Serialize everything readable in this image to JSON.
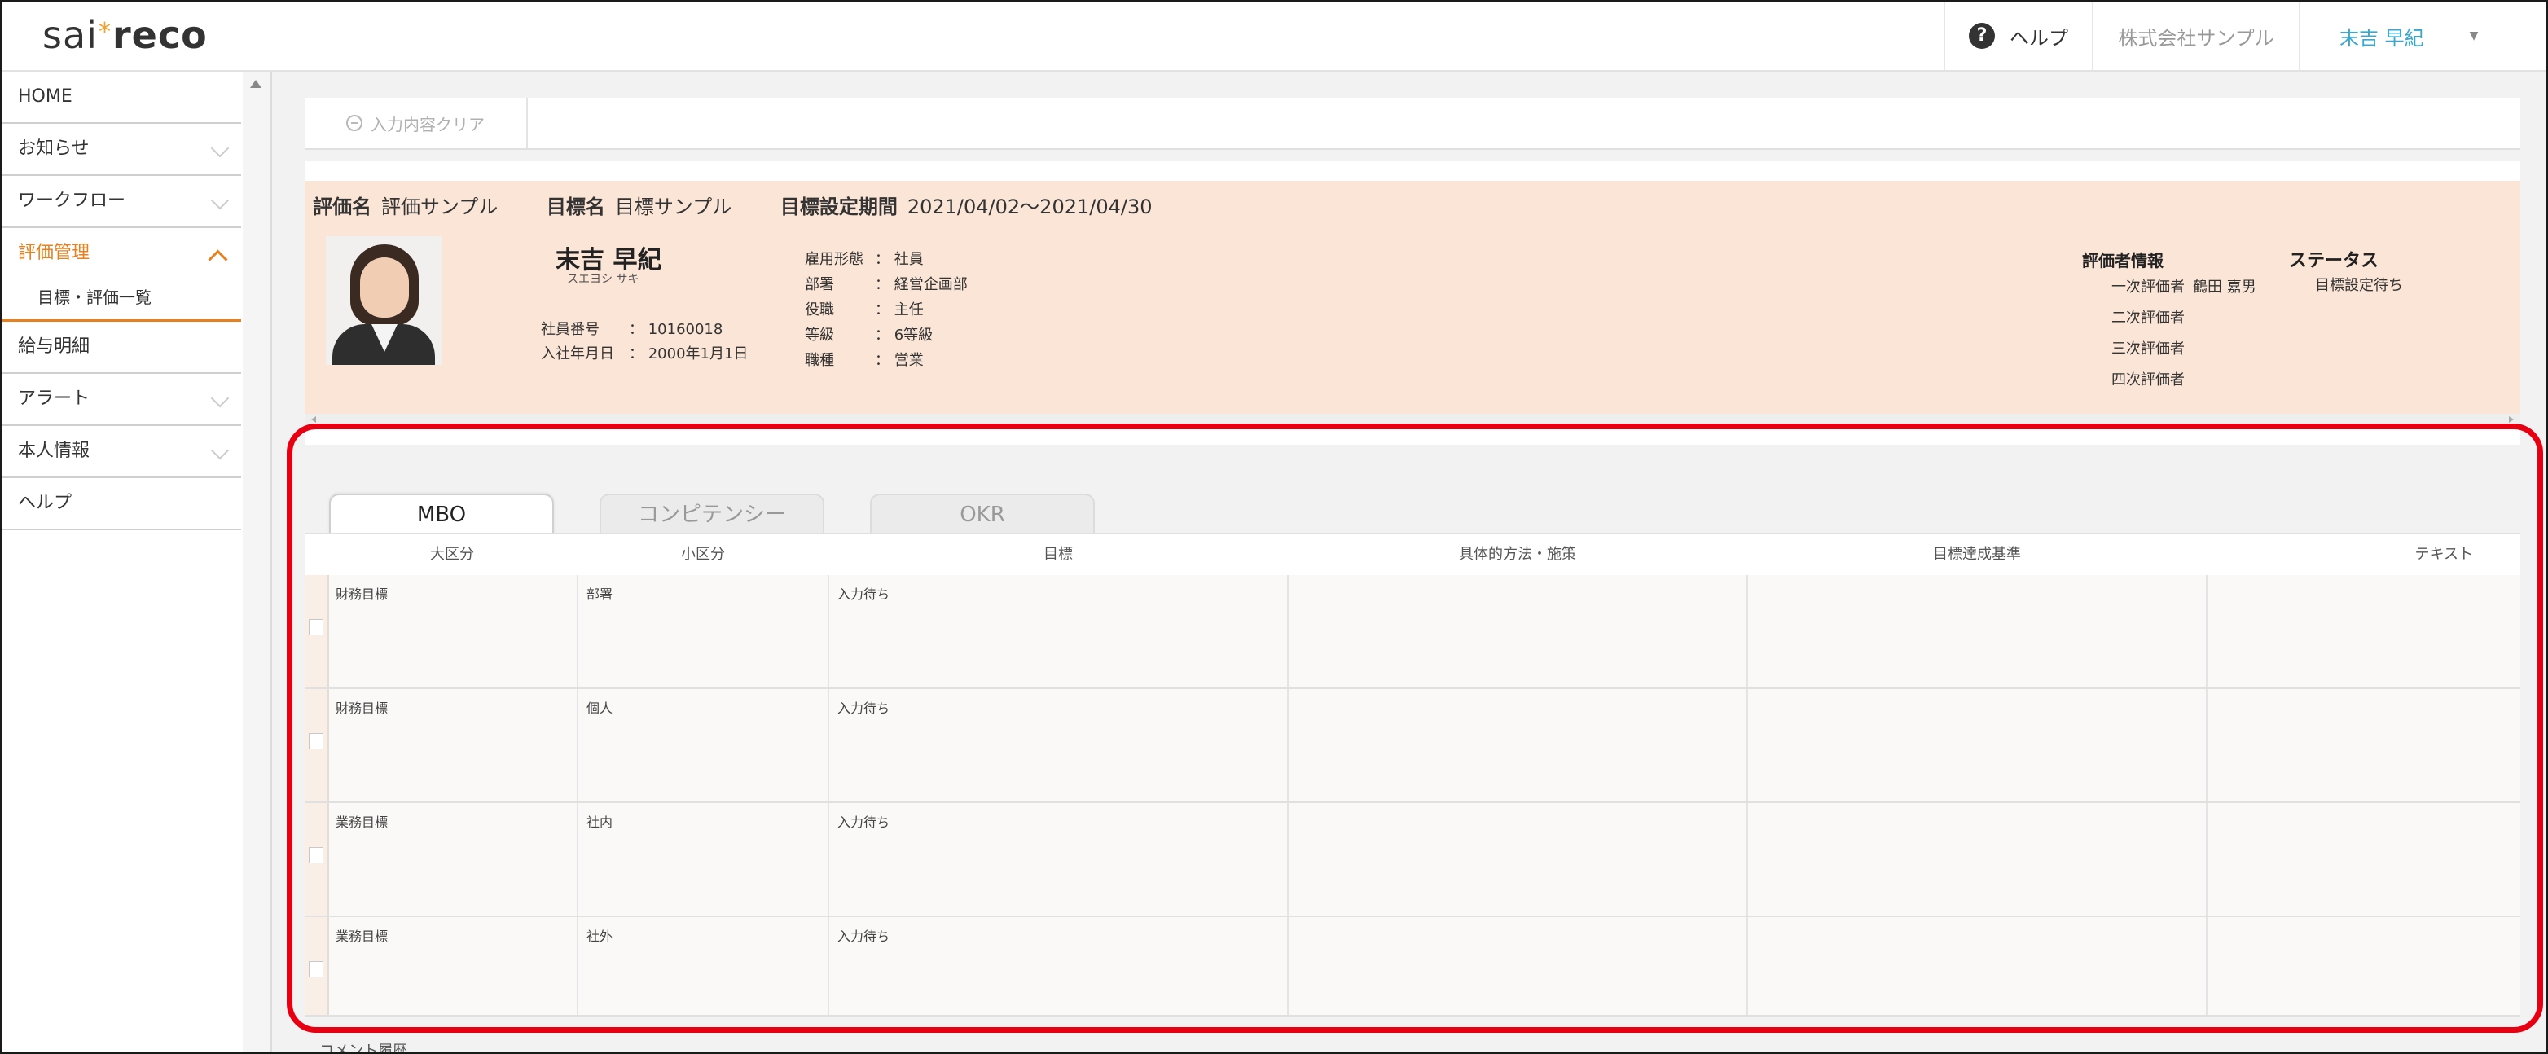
{
  "header": {
    "logo_left": "sai",
    "logo_star": "*",
    "logo_right": "reco",
    "help_icon": "?",
    "help_label": "ヘルプ",
    "company": "株式会社サンプル",
    "user": "末吉 早紀",
    "user_caret": "▼"
  },
  "sidebar": {
    "items": [
      {
        "label": "HOME"
      },
      {
        "label": "お知らせ"
      },
      {
        "label": "ワークフロー"
      },
      {
        "label": "評価管理"
      },
      {
        "label": "目標・評価一覧"
      },
      {
        "label": "給与明細"
      },
      {
        "label": "アラート"
      },
      {
        "label": "本人情報"
      },
      {
        "label": "ヘルプ"
      }
    ]
  },
  "toolbar": {
    "clear_label": "入力内容クリア"
  },
  "evaluation": {
    "eval_name_label": "評価名",
    "eval_name": "評価サンプル",
    "target_name_label": "目標名",
    "target_name": "目標サンプル",
    "period_label": "目標設定期間",
    "period": "2021/04/02〜2021/04/30"
  },
  "employee": {
    "name": "末吉 早紀",
    "kana": "スエヨシ サキ",
    "number_label": "社員番号",
    "number": "： 10160018",
    "joined_label": "入社年月日",
    "joined": "： 2000年1月1日",
    "details": [
      {
        "label": "雇用形態",
        "value": "： 社員"
      },
      {
        "label": "部署",
        "value": "： 経営企画部"
      },
      {
        "label": "役職",
        "value": "： 主任"
      },
      {
        "label": "等級",
        "value": "： 6等級"
      },
      {
        "label": "職種",
        "value": "： 営業"
      }
    ]
  },
  "evaluators": {
    "title": "評価者情報",
    "list": [
      {
        "label": "一次評価者",
        "name": "鶴田 嘉男"
      },
      {
        "label": "二次評価者",
        "name": ""
      },
      {
        "label": "三次評価者",
        "name": ""
      },
      {
        "label": "四次評価者",
        "name": ""
      }
    ]
  },
  "status": {
    "title": "ステータス",
    "value": "目標設定待ち"
  },
  "tabs": [
    {
      "label": "MBO",
      "active": true
    },
    {
      "label": "コンピテンシー",
      "active": false
    },
    {
      "label": "OKR",
      "active": false
    }
  ],
  "table": {
    "headers": [
      "大区分",
      "小区分",
      "目標",
      "具体的方法・施策",
      "目標達成基準",
      "テキスト"
    ],
    "rows": [
      {
        "major": "財務目標",
        "minor": "部署",
        "goal": "入力待ち"
      },
      {
        "major": "財務目標",
        "minor": "個人",
        "goal": "入力待ち"
      },
      {
        "major": "業務目標",
        "minor": "社内",
        "goal": "入力待ち"
      },
      {
        "major": "業務目標",
        "minor": "社外",
        "goal": "入力待ち"
      }
    ]
  },
  "comment_history": "コメント履歴",
  "colors": {
    "accent": "#e8801e",
    "highlight": "#e60012",
    "info_bg": "#fbe5d6",
    "user_link": "#38a8d0"
  }
}
